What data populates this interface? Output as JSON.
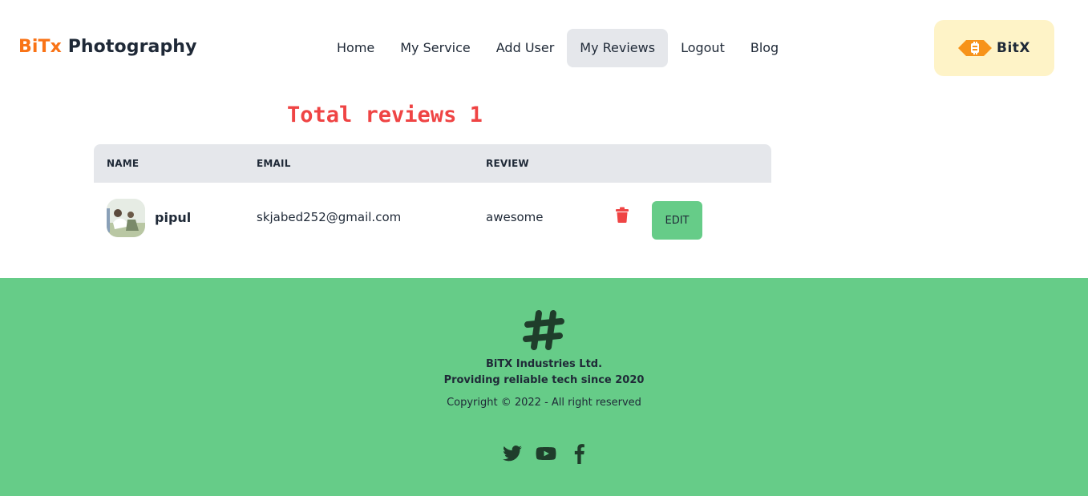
{
  "header": {
    "brand_part1": "BiTx",
    "brand_part2": "Photography",
    "nav": [
      {
        "label": "Home",
        "active": false
      },
      {
        "label": "My Service",
        "active": false
      },
      {
        "label": "Add User",
        "active": false
      },
      {
        "label": "My Reviews",
        "active": true
      },
      {
        "label": "Logout",
        "active": false
      },
      {
        "label": "Blog",
        "active": false
      }
    ],
    "logo_text": "BitX"
  },
  "main": {
    "heading": "Total reviews 1",
    "table": {
      "headers": [
        "NAME",
        "EMAIL",
        "REVIEW"
      ],
      "rows": [
        {
          "name": "pipul",
          "email": "skjabed252@gmail.com",
          "review": "awesome",
          "edit_label": "EDIT"
        }
      ]
    }
  },
  "footer": {
    "company": "BiTX Industries Ltd.",
    "tagline": "Providing reliable tech since 2020",
    "copyright": "Copyright © 2022 - All right reserved",
    "socials": [
      "twitter-icon",
      "youtube-icon",
      "facebook-icon"
    ]
  },
  "colors": {
    "brand_orange": "#f97316",
    "heading_red": "#ef4444",
    "footer_green": "#66cc88",
    "active_nav_bg": "#e5e7eb",
    "logo_bg": "#fef3c7"
  }
}
